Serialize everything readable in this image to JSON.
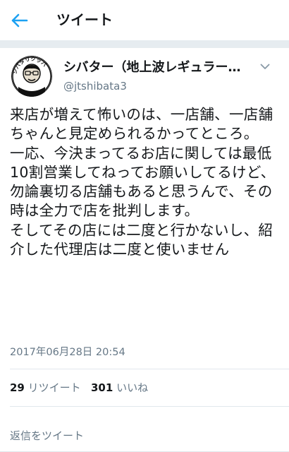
{
  "header": {
    "back_icon": "arrow-left-icon",
    "title": "ツイート"
  },
  "tweet": {
    "avatar_text": "シバタリクッパ",
    "display_name": "シバター（地上波レギュラー…",
    "username": "@jtshibata3",
    "text": "来店が増えて怖いのは、一店舗、一店舗ちゃんと見定められるかってところ。\n一応、今決まってるお店に関しては最低10割営業してねってお願いしてるけど、勿論裏切る店舗もあると思うんで、その時は全力で店を批判します。\nそしてその店には二度と行かないし、紹介した代理店は二度と使いません",
    "timestamp": "2017年06月28日 20:54",
    "retweet_count": "29",
    "retweet_label": "リツイート",
    "like_count": "301",
    "like_label": "いいね",
    "reply_label": "返信をツイート"
  },
  "colors": {
    "accent": "#1da1f2",
    "text": "#14171a",
    "muted": "#657786",
    "separator": "#e6ecf0"
  }
}
